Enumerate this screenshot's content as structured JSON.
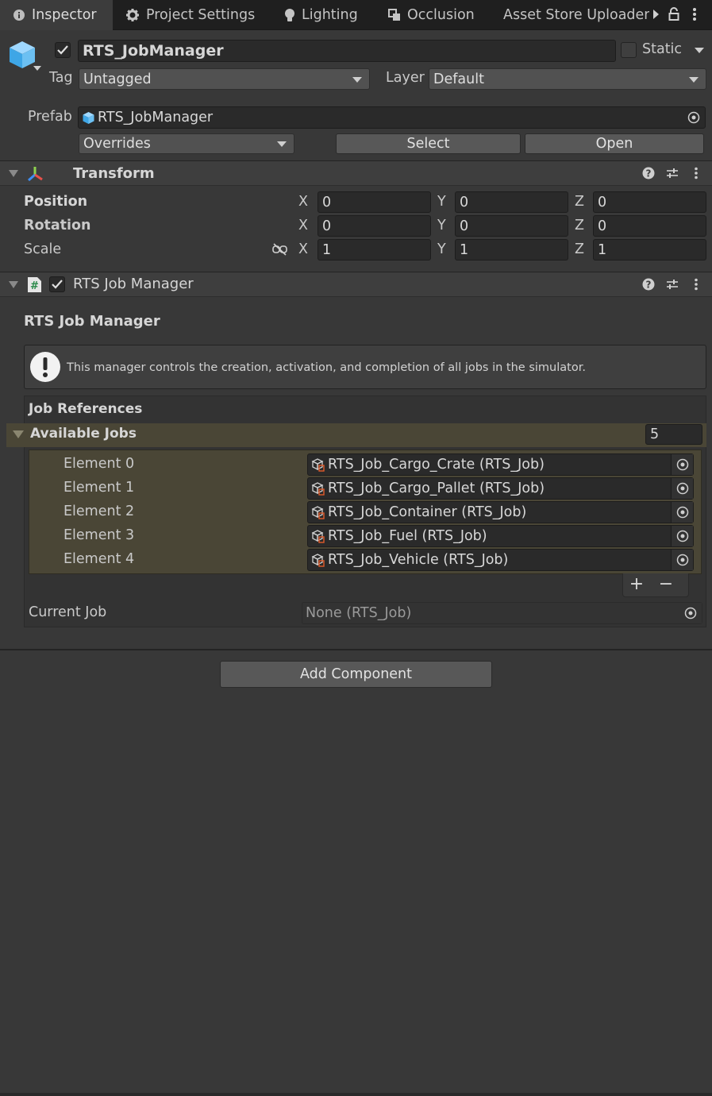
{
  "tabs": [
    {
      "label": "Inspector",
      "icon": "info-icon",
      "active": true
    },
    {
      "label": "Project Settings",
      "icon": "gear-icon"
    },
    {
      "label": "Lighting",
      "icon": "bulb-icon"
    },
    {
      "label": "Occlusion",
      "icon": "occlusion-icon"
    },
    {
      "label": "Asset Store Uploader",
      "icon": "store-icon"
    }
  ],
  "gameobject": {
    "name": "RTS_JobManager",
    "static_label": "Static",
    "tag_label": "Tag",
    "tag_value": "Untagged",
    "layer_label": "Layer",
    "layer_value": "Default",
    "prefab_label": "Prefab",
    "prefab_value": "RTS_JobManager",
    "overrides_label": "Overrides",
    "select_label": "Select",
    "open_label": "Open"
  },
  "transform": {
    "title": "Transform",
    "rows": [
      {
        "label": "Position",
        "x": "0",
        "y": "0",
        "z": "0"
      },
      {
        "label": "Rotation",
        "x": "0",
        "y": "0",
        "z": "0"
      },
      {
        "label": "Scale",
        "x": "1",
        "y": "1",
        "z": "1"
      }
    ],
    "axis": {
      "x": "X",
      "y": "Y",
      "z": "Z"
    }
  },
  "job_manager": {
    "title": "RTS Job Manager",
    "section_title": "RTS Job Manager",
    "help_text": "This manager controls the creation, activation, and completion of all jobs in the simulator.",
    "job_references_label": "Job References",
    "available_jobs_label": "Available Jobs",
    "available_jobs_count": "5",
    "elements": [
      {
        "label": "Element 0",
        "value": "RTS_Job_Cargo_Crate (RTS_Job)"
      },
      {
        "label": "Element 1",
        "value": "RTS_Job_Cargo_Pallet (RTS_Job)"
      },
      {
        "label": "Element 2",
        "value": "RTS_Job_Container (RTS_Job)"
      },
      {
        "label": "Element 3",
        "value": "RTS_Job_Fuel (RTS_Job)"
      },
      {
        "label": "Element 4",
        "value": "RTS_Job_Vehicle (RTS_Job)"
      }
    ],
    "add_symbol": "+",
    "remove_symbol": "−",
    "current_job_label": "Current Job",
    "current_job_value": "None (RTS_Job)"
  },
  "add_component_label": "Add Component",
  "colors": {
    "background": "#383838",
    "tab_bar": "#1f1f1f",
    "list_highlight": "#4a4636",
    "prefab_blue": "#5db8f0"
  }
}
